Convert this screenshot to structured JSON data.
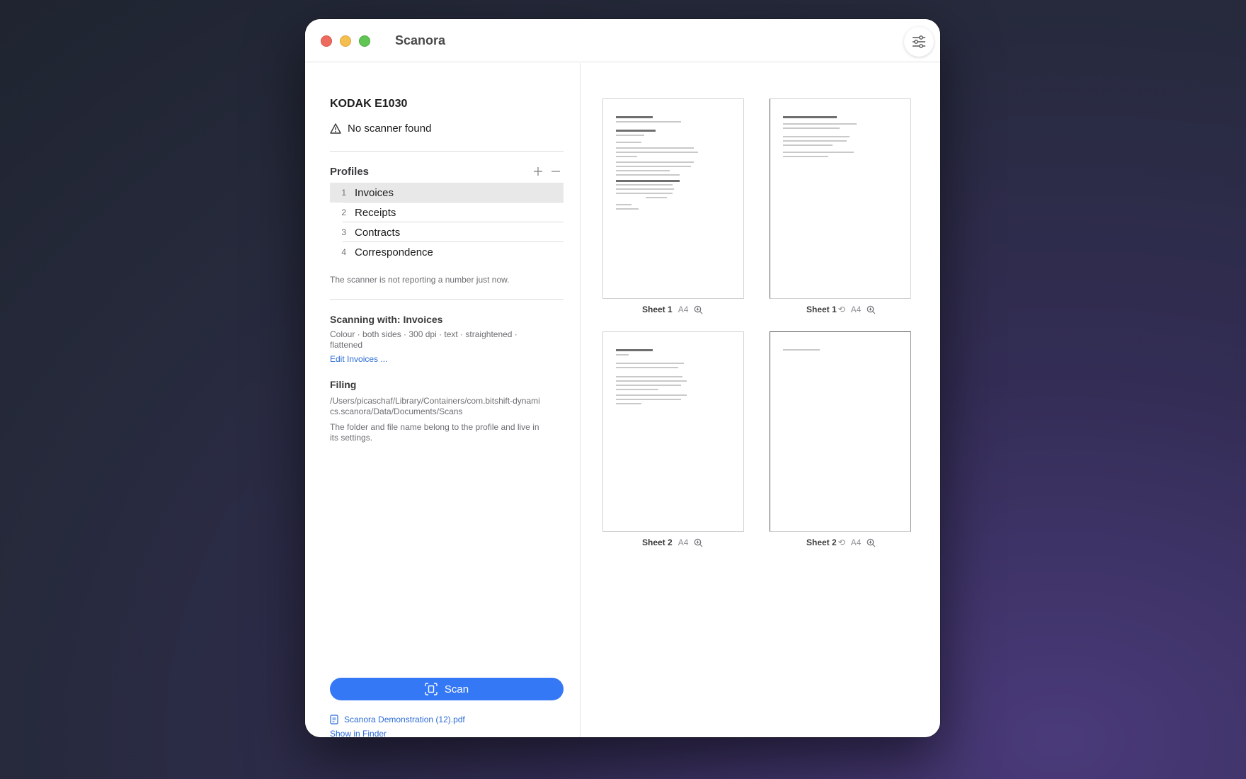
{
  "window": {
    "title": "Scanora"
  },
  "scanner": {
    "name": "KODAK E1030",
    "status": "No scanner found"
  },
  "profiles": {
    "title": "Profiles",
    "items": [
      {
        "num": "1",
        "label": "Invoices"
      },
      {
        "num": "2",
        "label": "Receipts"
      },
      {
        "num": "3",
        "label": "Contracts"
      },
      {
        "num": "4",
        "label": "Correspondence"
      }
    ],
    "selected": "Invoices",
    "note": "The scanner is not reporting a number just now."
  },
  "scanning": {
    "title": "Scanning with: Invoices",
    "summary": "Colour · both sides · 300 dpi · text · straightened · flattened",
    "edit_link": "Edit Invoices ..."
  },
  "filing": {
    "title": "Filing",
    "path": "/Users/picaschaf/Library/Containers/com.bitshift-dynamics.scanora/Data/Documents/Scans",
    "note": "The folder and file name belong to the profile and live in its settings."
  },
  "scan_button": {
    "label": "Scan"
  },
  "last_file": {
    "name": "Scanora Demonstration (12).pdf",
    "show_in_finder": "Show in Finder"
  },
  "sheets": [
    {
      "name": "Sheet 1",
      "back_marker": "",
      "size": "A4"
    },
    {
      "name": "Sheet 1",
      "back_marker": "⟲",
      "size": "A4"
    },
    {
      "name": "Sheet 2",
      "back_marker": "",
      "size": "A4"
    },
    {
      "name": "Sheet 2",
      "back_marker": "⟲",
      "size": "A4"
    }
  ],
  "colors": {
    "accent": "#3478f6",
    "link": "#2b6bd6"
  }
}
